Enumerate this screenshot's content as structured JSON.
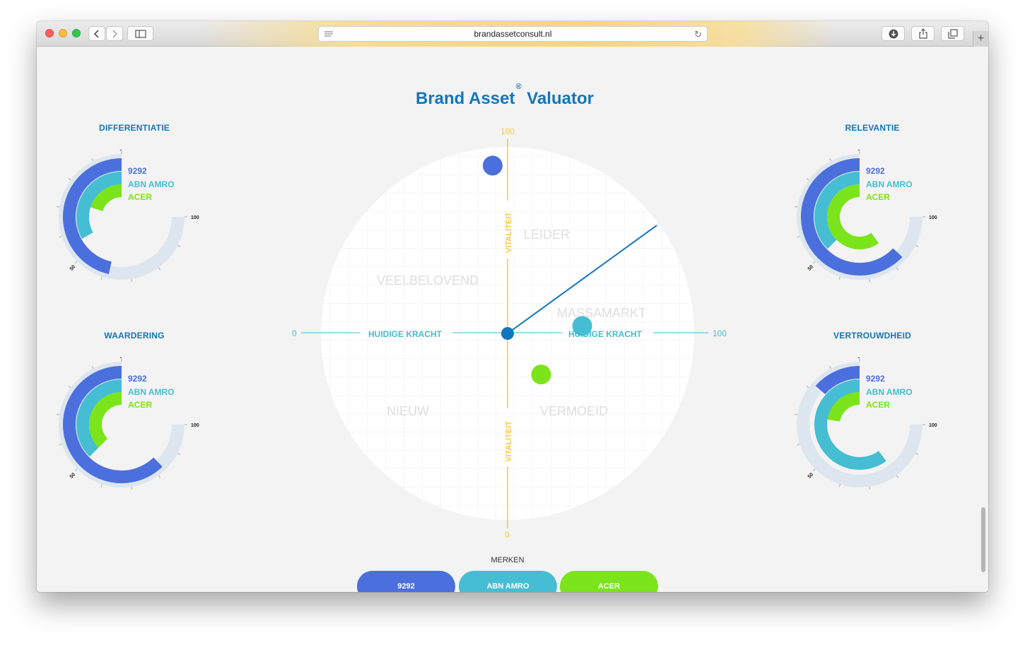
{
  "browser": {
    "url": "brandassetconsult.nl"
  },
  "page": {
    "title_part1": "Brand Asset",
    "title_reg": "®",
    "title_part2": "Valuator"
  },
  "brands": [
    {
      "name": "9292",
      "color": "#4b6fdc"
    },
    {
      "name": "ABN AMRO",
      "color": "#45bdd2"
    },
    {
      "name": "ACER",
      "color": "#7be41a"
    }
  ],
  "gauges": [
    {
      "title": "DIFFERENTIATIE",
      "label_0": "0",
      "label_50": "50",
      "label_100": "100",
      "values": [
        62,
        44,
        27
      ]
    },
    {
      "title": "RELEVANTIE",
      "label_0": "0",
      "label_50": "50",
      "label_100": "100",
      "values": [
        84,
        50,
        80
      ]
    },
    {
      "title": "WAARDERING",
      "label_0": "0",
      "label_50": "50",
      "label_100": "100",
      "values": [
        83,
        50,
        50
      ]
    },
    {
      "title": "VERTROUWDHEID",
      "label_0": "0",
      "label_50": "50",
      "label_100": "100",
      "values": [
        18,
        80,
        30
      ]
    }
  ],
  "matrix": {
    "x_axis_label": "HUIDIGE KRACHT",
    "y_axis_label": "VITALITEIT",
    "x_min": "0",
    "x_max": "100",
    "y_min": "0",
    "y_max": "100",
    "quadrants": {
      "leider": "LEIDER",
      "veelbelovend": "VEELBELOVEND",
      "massamarkt": "MASSAMARKT",
      "nieuw": "NIEUW",
      "vermoeid": "VERMOEID"
    },
    "points": [
      {
        "brand": "9292",
        "x": 46,
        "y": 95
      },
      {
        "brand": "ABN AMRO",
        "x": 70,
        "y": 52
      },
      {
        "brand": "ACER",
        "x": 59,
        "y": 39
      }
    ],
    "ray_end": {
      "x": 90,
      "y": 79
    }
  },
  "merken_label": "MERKEN",
  "colors": {
    "accent_blue": "#1276bd",
    "axis_yellow": "#f5c842",
    "axis_cyan": "#45bdd2",
    "track": "#dde6ef"
  }
}
